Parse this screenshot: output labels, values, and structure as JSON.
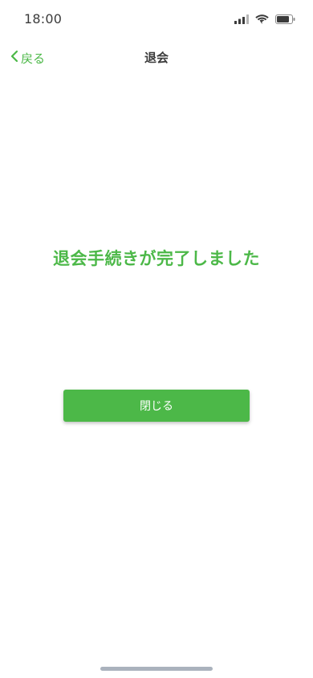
{
  "status_bar": {
    "time": "18:00",
    "icons": [
      "cellular-signal-icon",
      "wifi-icon",
      "battery-icon"
    ]
  },
  "nav": {
    "back_label": "戻る",
    "title": "退会",
    "back_icon": "chevron-left-icon"
  },
  "main": {
    "message": "退会手続きが完了しました",
    "close_button_label": "閉じる"
  },
  "colors": {
    "accent": "#4cb848",
    "title_text": "#3a3a3a",
    "status_text": "#3b3b3b",
    "home_indicator": "#aab2bd"
  }
}
